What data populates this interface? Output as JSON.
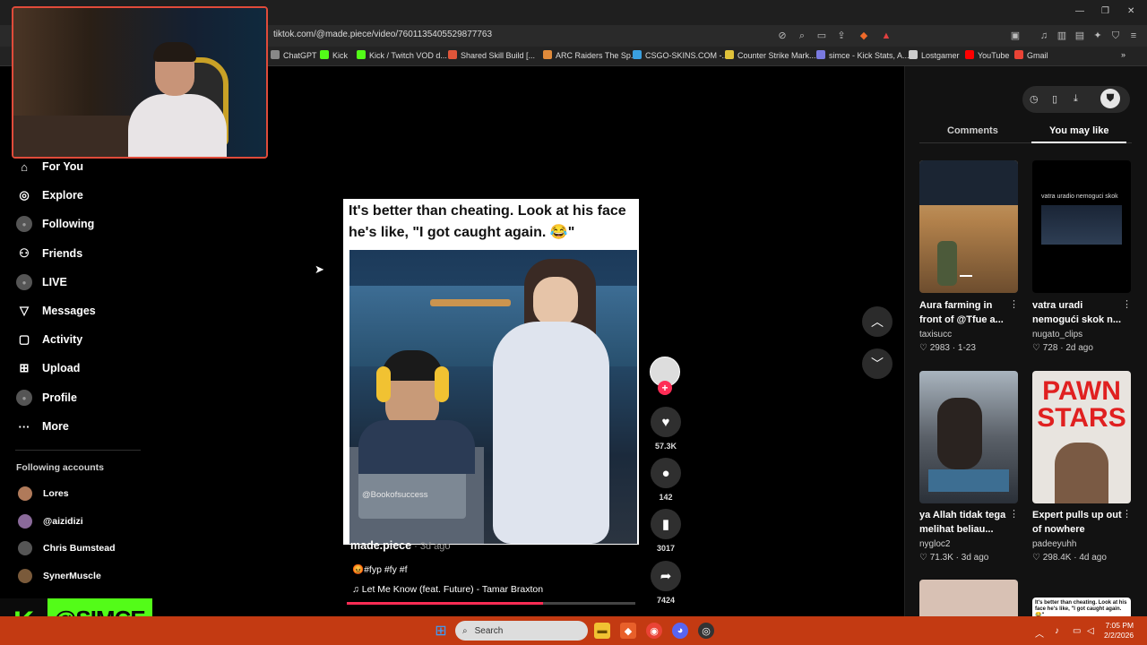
{
  "browser": {
    "url": "tiktok.com/@made.piece/video/7601135405529877763",
    "bookmarks": [
      {
        "label": "ChatGPT",
        "color": "#888888"
      },
      {
        "label": "Kick",
        "color": "#53fc18"
      },
      {
        "label": "Kick / Twitch VOD d...",
        "color": "#53fc18"
      },
      {
        "label": "Shared Skill Build [...",
        "color": "#e0553a"
      },
      {
        "label": "ARC Raiders The Sp...",
        "color": "#e08a3a"
      },
      {
        "label": "CSGO-SKINS.COM -...",
        "color": "#3aa0e0"
      },
      {
        "label": "Counter Strike Mark...",
        "color": "#e0c23a"
      },
      {
        "label": "simce - Kick Stats, A...",
        "color": "#7a7ae0"
      },
      {
        "label": "Lostgamer",
        "color": "#cccccc"
      },
      {
        "label": "YouTube",
        "color": "#ff0000"
      },
      {
        "label": "Gmail",
        "color": "#ea4335"
      }
    ]
  },
  "sidebar": {
    "nav": [
      {
        "label": "For You",
        "icon": "home-icon"
      },
      {
        "label": "Explore",
        "icon": "compass-icon"
      },
      {
        "label": "Following",
        "icon": "following-avatar-icon"
      },
      {
        "label": "Friends",
        "icon": "friends-icon"
      },
      {
        "label": "LIVE",
        "icon": "live-avatar-icon"
      },
      {
        "label": "Messages",
        "icon": "send-icon"
      },
      {
        "label": "Activity",
        "icon": "activity-icon"
      },
      {
        "label": "Upload",
        "icon": "plus-square-icon"
      },
      {
        "label": "Profile",
        "icon": "profile-avatar-icon"
      },
      {
        "label": "More",
        "icon": "ellipsis-icon"
      }
    ],
    "following_header": "Following accounts",
    "following": [
      {
        "name": "Lores",
        "color": "#b07a5a"
      },
      {
        "name": "@aizidizi",
        "color": "#8a6a9a"
      },
      {
        "name": "Chris Bumstead",
        "color": "#555555"
      },
      {
        "name": "SynerMuscle",
        "color": "#7a5a3a"
      }
    ]
  },
  "overlay": {
    "kick_logo": "K",
    "channel": "@SIMCE"
  },
  "video": {
    "caption": "It's better than cheating. Look at his face he's like, \"I got caught again. 😂\"",
    "watermark": "@Bookofsuccess",
    "author": "made.piece",
    "age": " · 3d ago",
    "description": "😡#fyp #fy #f",
    "music": "♫   Let Me Know (feat. Future) - Tamar Braxton",
    "progress": 0.68
  },
  "actions": {
    "likes": "57.3K",
    "comments": "142",
    "saves": "3017",
    "shares": "7424"
  },
  "right_panel": {
    "tabs": [
      "Comments",
      "You may like"
    ],
    "active_tab": 1,
    "cards": [
      {
        "title": "Aura farming in front of @Tfue a...",
        "user": "taxisucc",
        "likes": "2983",
        "date": "1-23"
      },
      {
        "title": "vatra uradi nemogući skok n...",
        "user": "nugato_clips",
        "likes": "728",
        "date": "2d ago",
        "thumb_text": "vatra uradio nemoguci skok"
      },
      {
        "title": "ya Allah tidak tega melihat beliau...",
        "user": "nygloc2",
        "likes": "71.3K",
        "date": "3d ago"
      },
      {
        "title": "Expert pulls up out of nowhere",
        "user": "padeeyuhh",
        "likes": "298.4K",
        "date": "4d ago",
        "thumb_text": "PAWN STARS"
      }
    ],
    "partial_thumb_text": "It's better than cheating. Look at his face he's like, \"I got caught again. 😂\""
  },
  "taskbar": {
    "search": "Search",
    "time": "7:05 PM",
    "date": "2/2/2026"
  }
}
